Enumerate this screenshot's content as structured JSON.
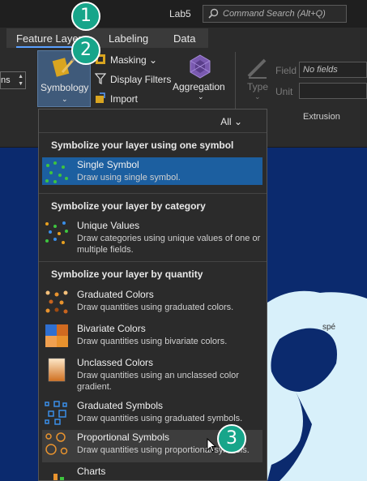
{
  "window": {
    "title": "Lab5"
  },
  "search": {
    "placeholder": "Command Search (Alt+Q)"
  },
  "tabs": [
    {
      "label": "Feature Layer"
    },
    {
      "label": "Labeling"
    },
    {
      "label": "Data"
    }
  ],
  "ribbon": {
    "spin_value": "ns",
    "symbology_label": "Symbology",
    "masking_label": "Masking",
    "display_filters_label": "Display Filters",
    "import_label": "Import",
    "aggregation_label": "Aggregation",
    "type_label": "Type",
    "field_label": "Field",
    "field_value": "No fields",
    "unit_label": "Unit",
    "extrusion_label": "Extrusion"
  },
  "map": {
    "place_label": "spé"
  },
  "dropdown": {
    "filter_label": "All",
    "sections": [
      {
        "heading": "Symbolize your layer using one symbol"
      },
      {
        "heading": "Symbolize your layer by category"
      },
      {
        "heading": "Symbolize your layer by quantity"
      }
    ],
    "items": [
      {
        "title": "Single Symbol",
        "desc": "Draw using single symbol.",
        "icon": "single-symbol-icon"
      },
      {
        "title": "Unique Values",
        "desc": "Draw categories using unique values of one or multiple fields.",
        "icon": "unique-values-icon"
      },
      {
        "title": "Graduated Colors",
        "desc": "Draw quantities using graduated colors.",
        "icon": "graduated-colors-icon"
      },
      {
        "title": "Bivariate Colors",
        "desc": "Draw quantities using bivariate colors.",
        "icon": "bivariate-colors-icon"
      },
      {
        "title": "Unclassed Colors",
        "desc": "Draw quantities using an unclassed color gradient.",
        "icon": "unclassed-colors-icon"
      },
      {
        "title": "Graduated Symbols",
        "desc": "Draw quantities using graduated symbols.",
        "icon": "graduated-symbols-icon"
      },
      {
        "title": "Proportional Symbols",
        "desc": "Draw quantities using proportional symbols.",
        "icon": "proportional-symbols-icon"
      },
      {
        "title": "Charts",
        "desc": "",
        "icon": "charts-icon"
      }
    ]
  },
  "badges": [
    {
      "num": "1"
    },
    {
      "num": "2"
    },
    {
      "num": "3"
    }
  ],
  "colors": {
    "accent": "#1c5fa0",
    "badge": "#17a58a",
    "map_water": "#0b2a6e",
    "map_land": "#d8f0fa"
  }
}
